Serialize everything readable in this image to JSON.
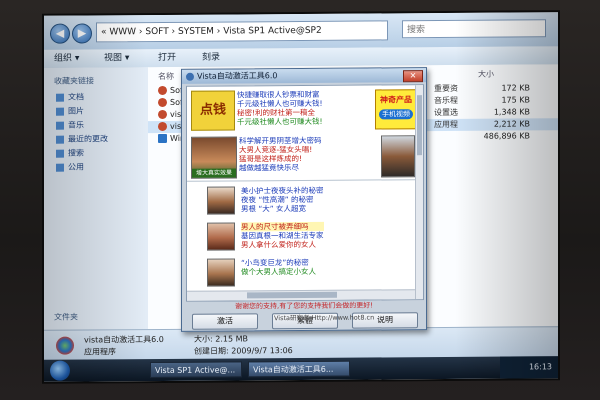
{
  "explorer": {
    "back_glyph": "◀",
    "forward_glyph": "▶",
    "address": "« WWW › SOFT › SYSTEM › Vista SP1 Active@SP2",
    "search_placeholder": "搜索",
    "toolbar": [
      "组织 ▾",
      "视图 ▾",
      "打开",
      "刻录"
    ],
    "sidebar_header": "收藏夹链接",
    "sidebar_items": [
      "文档",
      "图片",
      "音乐",
      "最近的更改",
      "搜索",
      "公用"
    ],
    "sidebar_footer": "文件夹",
    "column_name": "名称",
    "column_size": "大小",
    "files": [
      {
        "name": "Soft",
        "type": "重要资",
        "size": "172 KB"
      },
      {
        "name": "Soft",
        "type": "音乐程",
        "size": "175 KB"
      },
      {
        "name": "vista",
        "type": "设置选",
        "size": "1,348 KB"
      },
      {
        "name": "vista",
        "type": "应用程",
        "size": "2,212 KB"
      },
      {
        "name": "Win",
        "type": "",
        "size": "486,896 KB"
      }
    ],
    "details": {
      "name": "vista自动激活工具6.0",
      "type": "应用程序",
      "size": "大小: 2.15 MB",
      "created": "创建日期: 2009/9/7 13:06"
    }
  },
  "taskbar": {
    "buttons": [
      "Vista SP1 Active@...",
      "Vista自动激活工具6..."
    ],
    "clock": "16:13"
  },
  "dialog": {
    "title": "Vista自动激活工具6.0",
    "close_glyph": "✕",
    "ad_dianqian": "点钱",
    "ad_products": [
      "神奇产品",
      "手机视频"
    ],
    "ad_text_1": [
      "快捷赚取很人钞票和财富",
      "千元级社懒人也可赚大钱!",
      "秘密!利的财社第一稿全",
      "千元级社懒人也可赚大钱!"
    ],
    "ad_text_2": [
      "科学解开男阴茎增大密码",
      "大男人竞逐-猛女头唱!",
      "猛哥是这样炼成的!",
      "越做越猛竟快乐尽"
    ],
    "ad_thumb_caption": "增大真实效果",
    "list_items": [
      [
        "美小护士夜夜头补的秘密",
        "夜夜 “性高潮” 的秘密",
        "男根 “大” 女人超宽"
      ],
      [
        "男人的尺寸被弄细吗",
        "基因真根一和湖生活专家",
        "男人拿什么爱你的女人"
      ],
      [
        "“小鸟变巨龙”的秘密",
        "做个大男人搞定小女人"
      ]
    ],
    "footer_message": "谢谢您的支持,有了您的支持我们会做的更好!",
    "buttons": [
      "激活",
      "繁體",
      "说明"
    ],
    "credit": "Vista研究者  Http://www.hot8.cn"
  }
}
